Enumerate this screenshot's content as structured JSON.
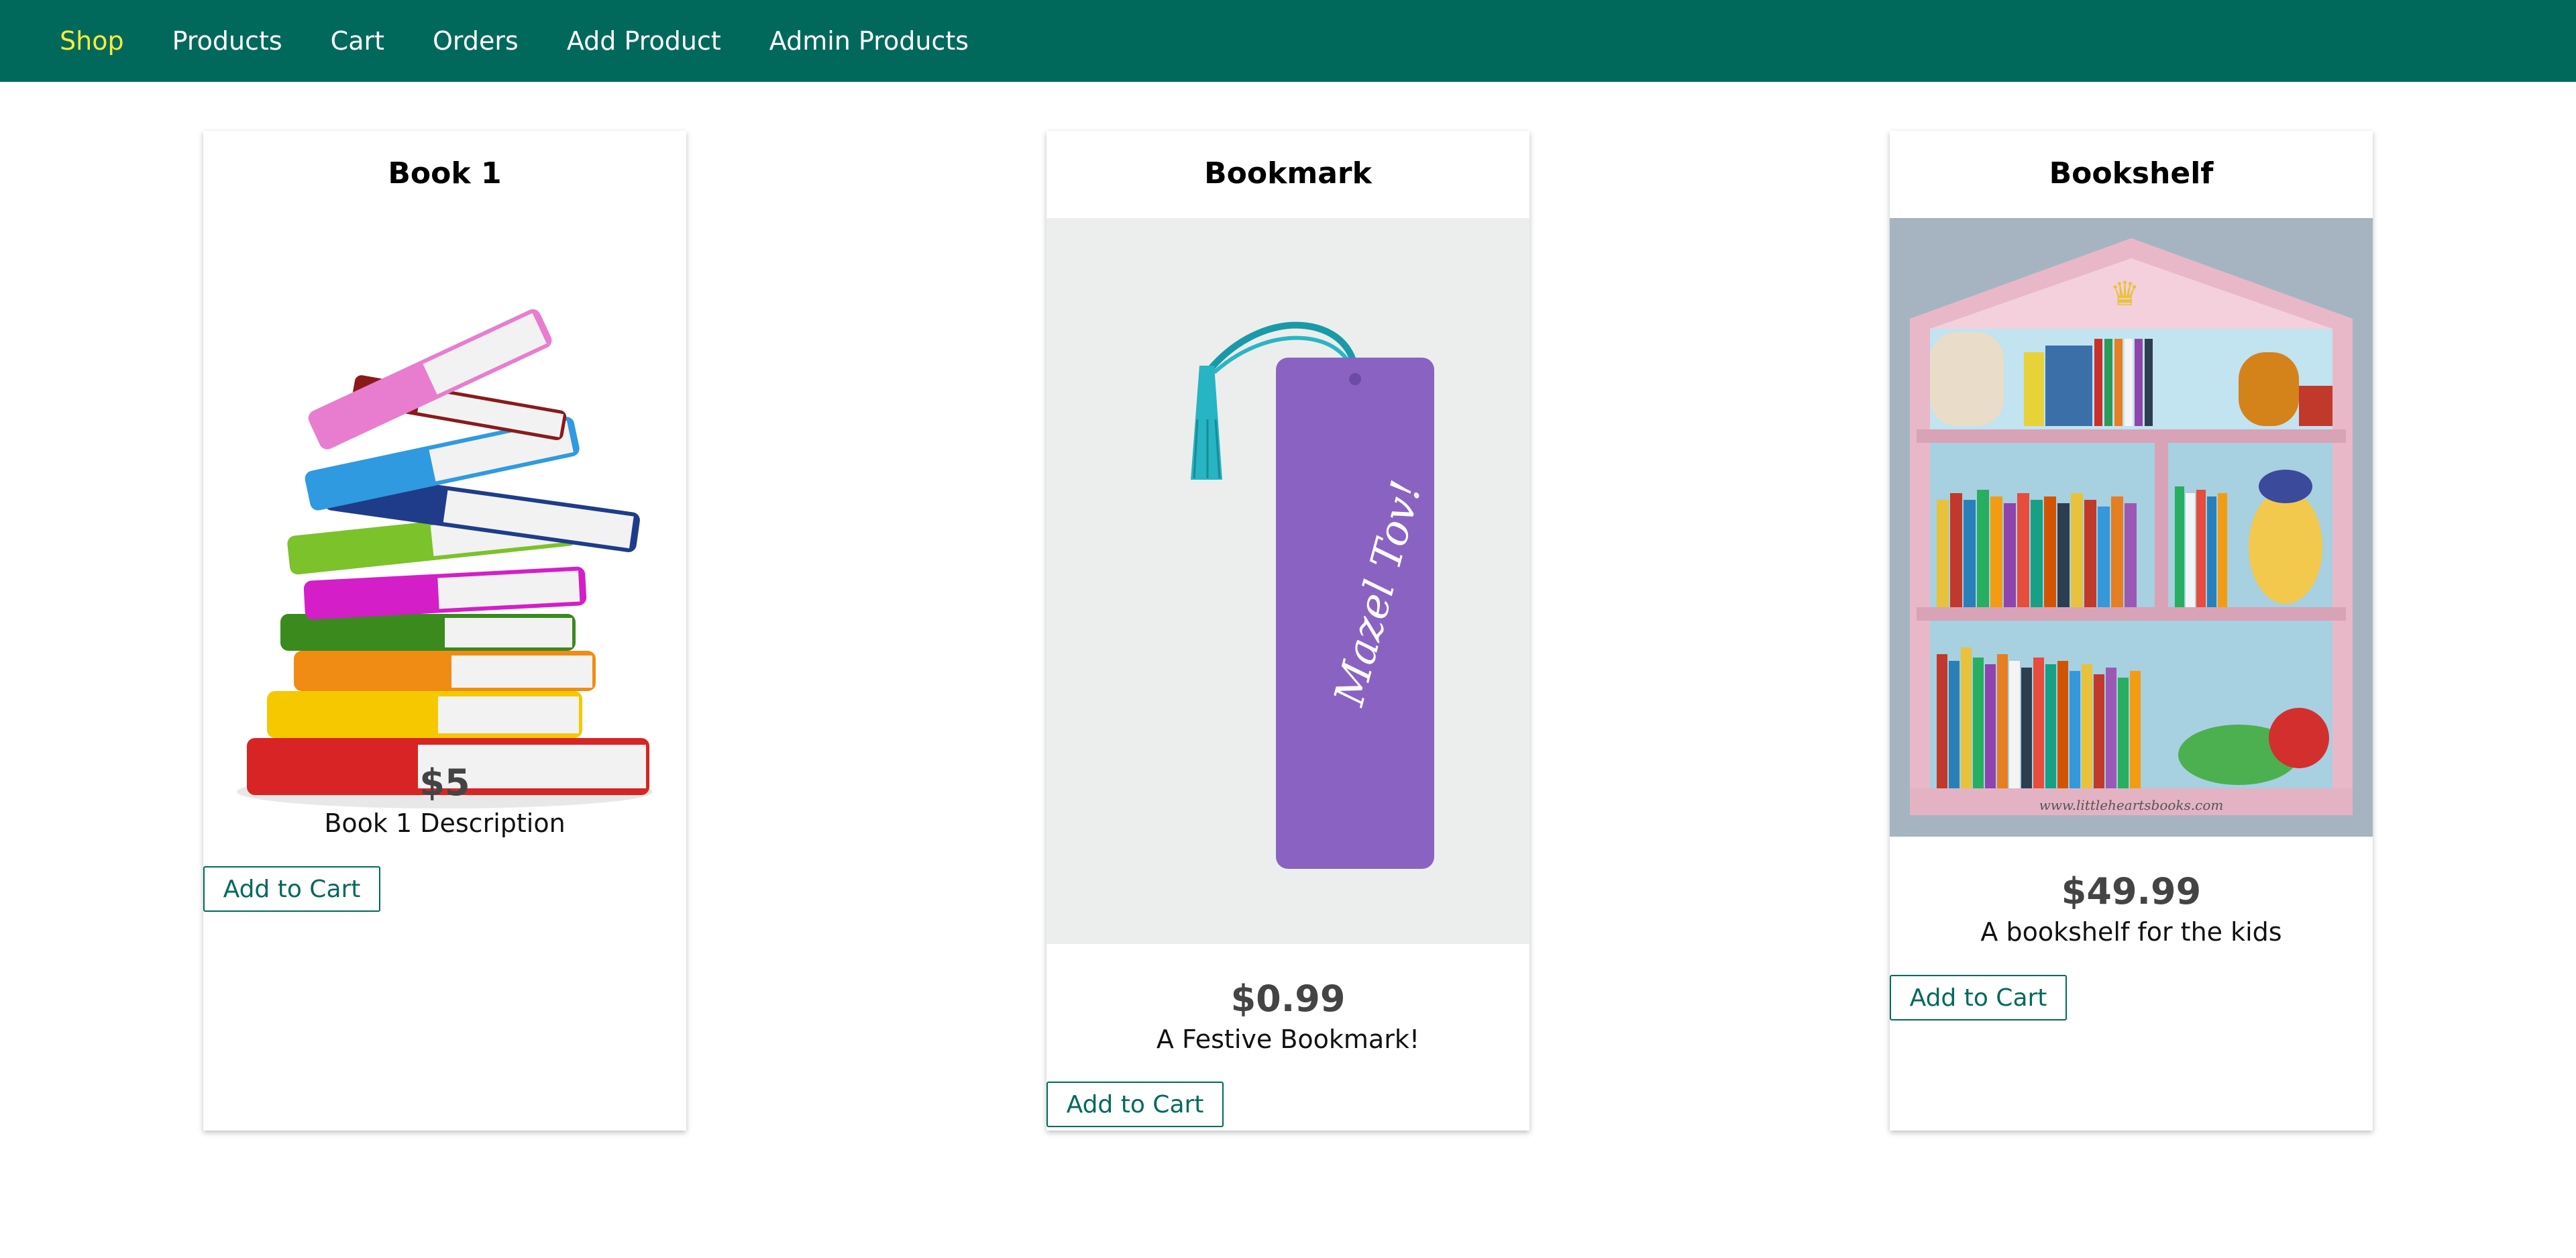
{
  "nav": {
    "items": [
      {
        "label": "Shop",
        "active": true
      },
      {
        "label": "Products"
      },
      {
        "label": "Cart"
      },
      {
        "label": "Orders"
      },
      {
        "label": "Add Product"
      },
      {
        "label": "Admin Products"
      }
    ]
  },
  "products": [
    {
      "title": "Book 1",
      "price": "$5",
      "description": "Book 1 Description",
      "button_label": "Add to Cart",
      "image": "stack-of-books"
    },
    {
      "title": "Bookmark",
      "price": "$0.99",
      "description": "A Festive Bookmark!",
      "button_label": "Add to Cart",
      "image": "purple-bookmark",
      "image_text": "Mazel Tov!"
    },
    {
      "title": "Bookshelf",
      "price": "$49.99",
      "description": "A bookshelf for the kids",
      "button_label": "Add to Cart",
      "image": "kids-bookshelf",
      "image_text": "www.littleheartsbooks.com"
    }
  ],
  "colors": {
    "header": "#00695c",
    "active_nav": "#ffeb3b",
    "button_border": "#00695c",
    "price_text": "#444444"
  }
}
